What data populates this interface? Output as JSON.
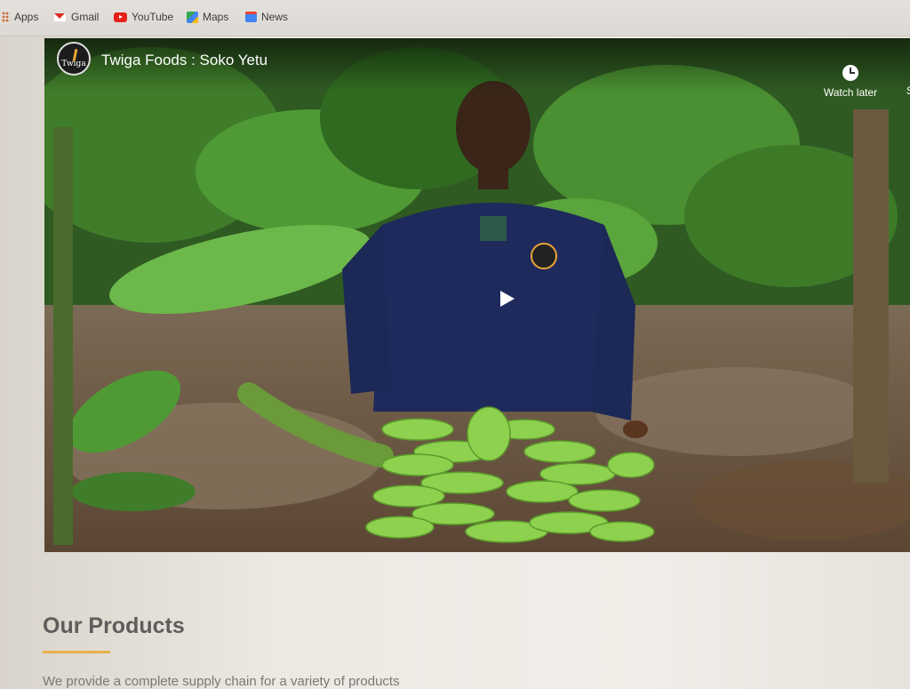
{
  "bookmarks": {
    "items": [
      {
        "label": "Apps",
        "icon": "apps-grid-icon"
      },
      {
        "label": "Gmail",
        "icon": "gmail-icon"
      },
      {
        "label": "YouTube",
        "icon": "youtube-icon"
      },
      {
        "label": "Maps",
        "icon": "maps-icon"
      },
      {
        "label": "News",
        "icon": "news-icon"
      }
    ]
  },
  "video": {
    "title": "Twiga Foods : Soko Yetu",
    "channel_logo_text": "Twiga",
    "watch_later_label": "Watch later",
    "share_label_partial": "S",
    "play_icon": "play-icon"
  },
  "section": {
    "title": "Our Products",
    "text": "We provide a complete supply chain for a variety of products",
    "accent_color": "#e8b04d"
  }
}
